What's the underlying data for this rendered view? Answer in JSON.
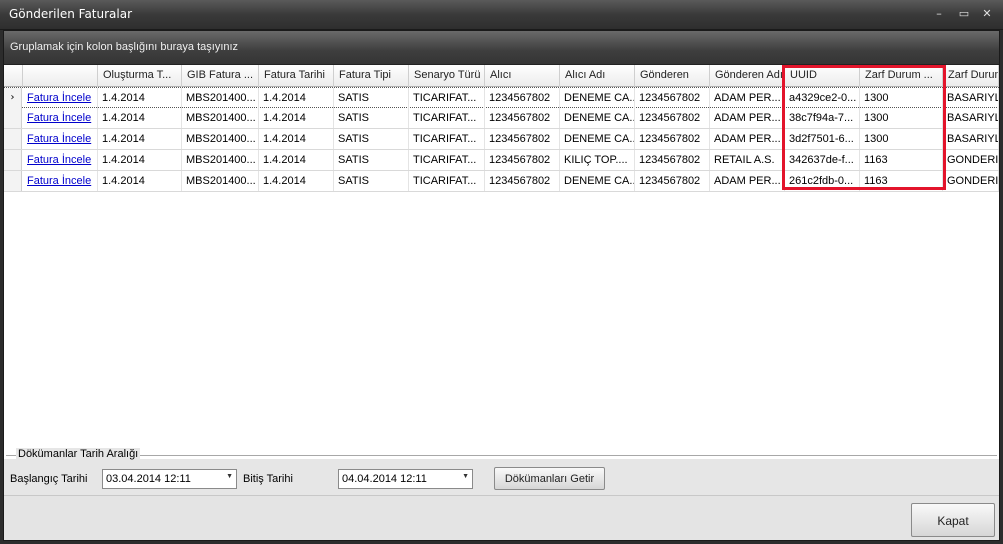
{
  "window": {
    "title": "Gönderilen Faturalar",
    "minimize_glyph": "–",
    "maximize_glyph": "▭",
    "close_glyph": "✕"
  },
  "group_hint": "Gruplamak için kolon başlığını buraya taşıyınız",
  "columns": [
    "Oluşturma T...",
    "GIB Fatura ...",
    "Fatura Tarihi",
    "Fatura Tipi",
    "Senaryo Türü",
    "Alıcı",
    "Alıcı Adı",
    "Gönderen",
    "Gönderen Adı",
    "UUID",
    "Zarf Durum ...",
    "Zarf Durum"
  ],
  "rows": [
    {
      "link": "Fatura İncele",
      "cells": [
        "1.4.2014",
        "MBS201400...",
        "1.4.2014",
        "SATIS",
        "TICARIFAT...",
        "1234567802",
        "DENEME CA...",
        "1234567802",
        "ADAM PER...",
        "a4329ce2-0...",
        "1300",
        "BASARIYLA"
      ]
    },
    {
      "link": "Fatura İncele",
      "cells": [
        "1.4.2014",
        "MBS201400...",
        "1.4.2014",
        "SATIS",
        "TICARIFAT...",
        "1234567802",
        "DENEME CA...",
        "1234567802",
        "ADAM PER...",
        "38c7f94a-7...",
        "1300",
        "BASARIYLA"
      ]
    },
    {
      "link": "Fatura İncele",
      "cells": [
        "1.4.2014",
        "MBS201400...",
        "1.4.2014",
        "SATIS",
        "TICARIFAT...",
        "1234567802",
        "DENEME CA...",
        "1234567802",
        "ADAM PER...",
        "3d2f7501-6...",
        "1300",
        "BASARIYLA"
      ]
    },
    {
      "link": "Fatura İncele",
      "cells": [
        "1.4.2014",
        "MBS201400...",
        "1.4.2014",
        "SATIS",
        "TICARIFAT...",
        "1234567802",
        "KILIÇ TOP....",
        "1234567802",
        "RETAIL A.S.",
        "342637de-f...",
        "1163",
        "GONDERILI"
      ]
    },
    {
      "link": "Fatura İncele",
      "cells": [
        "1.4.2014",
        "MBS201400...",
        "1.4.2014",
        "SATIS",
        "TICARIFAT...",
        "1234567802",
        "DENEME CA...",
        "1234567802",
        "ADAM PER...",
        "261c2fdb-0...",
        "1163",
        "GONDERILI"
      ]
    }
  ],
  "row_indicator": "›",
  "scrollbar": {
    "left_arrow": "◀",
    "right_arrow": "▶",
    "grip": "|||"
  },
  "date_range": {
    "legend": "Dökümanlar Tarih Aralığı",
    "start_label": "Başlangıç Tarihi",
    "start_value": "03.04.2014 12:11",
    "end_label": "Bitiş Tarihi",
    "end_value": "04.04.2014 12:11",
    "dropdown_glyph": "▼",
    "fetch_button": "Dökümanları Getir"
  },
  "close_button": "Kapat",
  "colors": {
    "highlight": "#e3142b",
    "link": "#0000cc"
  }
}
